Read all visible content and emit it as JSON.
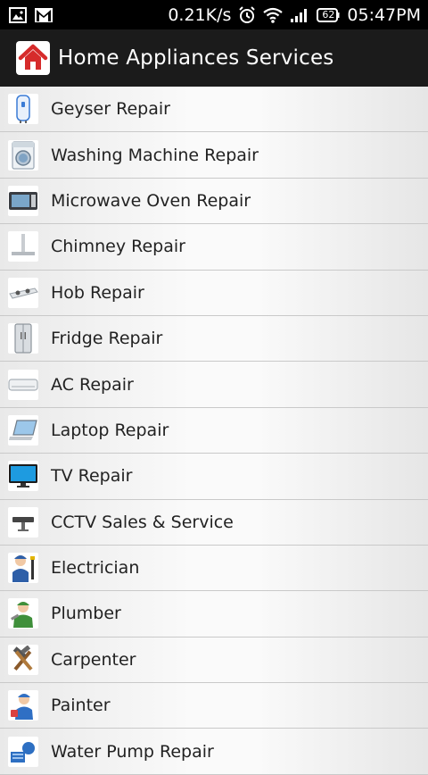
{
  "status_bar": {
    "net_speed": "0.21K/s",
    "battery": "62",
    "time": "05:47PM"
  },
  "app": {
    "title": "Home Appliances Services",
    "logo_icon": "house-icon"
  },
  "colors": {
    "actionbar": "#1b1b1b",
    "logo_red": "#d62b2b",
    "divider": "#c9c9c9"
  },
  "services": [
    {
      "label": "Geyser Repair",
      "icon": "geyser-icon"
    },
    {
      "label": "Washing Machine Repair",
      "icon": "washing-machine-icon"
    },
    {
      "label": "Microwave Oven Repair",
      "icon": "microwave-icon"
    },
    {
      "label": "Chimney Repair",
      "icon": "chimney-icon"
    },
    {
      "label": "Hob Repair",
      "icon": "hob-icon"
    },
    {
      "label": "Fridge Repair",
      "icon": "fridge-icon"
    },
    {
      "label": "AC Repair",
      "icon": "ac-icon"
    },
    {
      "label": "Laptop Repair",
      "icon": "laptop-icon"
    },
    {
      "label": "TV Repair",
      "icon": "tv-icon"
    },
    {
      "label": "CCTV Sales & Service",
      "icon": "cctv-icon"
    },
    {
      "label": "Electrician",
      "icon": "electrician-icon"
    },
    {
      "label": "Plumber",
      "icon": "plumber-icon"
    },
    {
      "label": "Carpenter",
      "icon": "carpenter-icon"
    },
    {
      "label": "Painter",
      "icon": "painter-icon"
    },
    {
      "label": "Water Pump Repair",
      "icon": "water-pump-icon"
    }
  ]
}
